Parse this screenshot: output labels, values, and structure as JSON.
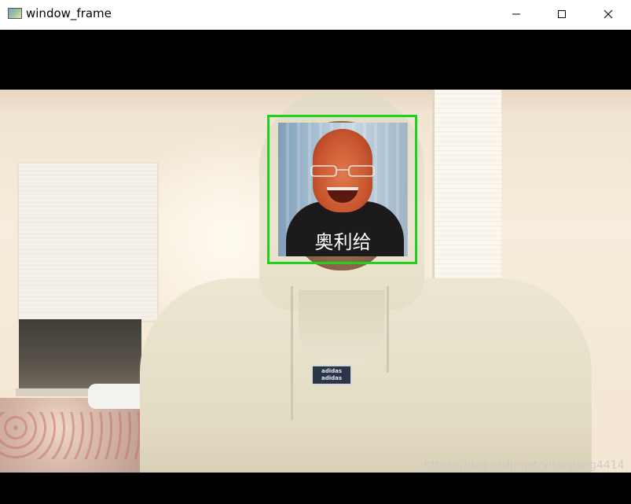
{
  "window": {
    "title": "window_frame",
    "icon": "app-image-icon",
    "controls": [
      "minimize-icon",
      "maximize-icon",
      "close-icon"
    ]
  },
  "detection": {
    "label": "奥利给",
    "box_color": "#1ed21e"
  },
  "hoodie_logo": [
    "adidas",
    "adidas"
  ],
  "watermark": "https://blog.csdn.net/yitanjiong4414"
}
